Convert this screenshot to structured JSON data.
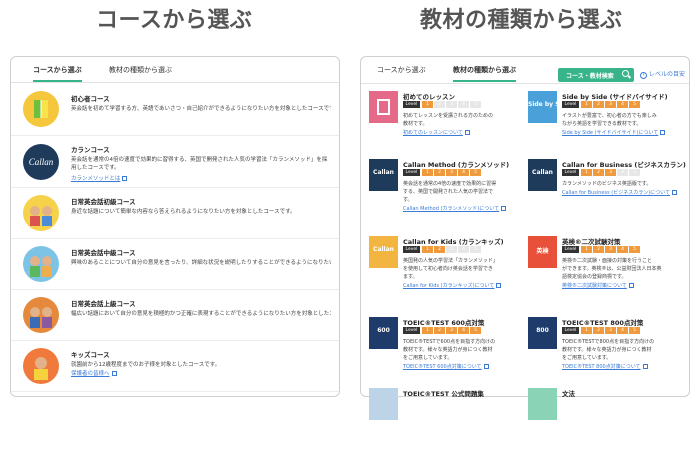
{
  "headings": {
    "left": "コースから選ぶ",
    "right": "教材の種類から選ぶ"
  },
  "left_panel": {
    "tabs": [
      {
        "label": "コースから選ぶ"
      },
      {
        "label": "教材の種類から選ぶ"
      }
    ],
    "courses": [
      {
        "title": "初心者コース",
        "desc": "英会話を初めて学習する方、英語であいさつ・自己紹介ができるようになりたい方を対象としたコースです。",
        "link": ""
      },
      {
        "title": "カランコース",
        "desc": "英会話を通常の4倍の速度で効果的に習得する、英国で開発された人気の学習法「カランメソッド」を採用したコースです。",
        "link": "カランメソッドとは"
      },
      {
        "title": "日常英会話初級コース",
        "desc": "身近な話題について簡単な内容なら答えられるようになりたい方を対象としたコースです。",
        "link": ""
      },
      {
        "title": "日常英会話中級コース",
        "desc": "興味のあることについて自分の意見を言ったり、詳細な状況を説明したりすることができるようになりたい方を対象としたコースです。",
        "link": ""
      },
      {
        "title": "日常英会話上級コース",
        "desc": "幅広い話題において自分の意見を積極的かつ正確に表現することができるようになりたい方を対象としたコースです。",
        "link": ""
      },
      {
        "title": "キッズコース",
        "desc": "就園前から12歳程度までのお子様を対象としたコースです。",
        "link": "保護者の皆様へ"
      }
    ]
  },
  "right_panel": {
    "tabs": [
      {
        "label": "コースから選ぶ"
      },
      {
        "label": "教材の種類から選ぶ"
      }
    ],
    "search_button": "コース・教材検索",
    "level_help": "レベルの目安",
    "level_label": "Level",
    "cards": [
      {
        "title": "初めてのレッスン",
        "level_on": 1,
        "desc": [
          "初めてレッスンを受講される方のための",
          "教材です。"
        ],
        "link": "初めてのレッスンについて",
        "thumb_color": "#e56a8a",
        "thumb_text": ""
      },
      {
        "title": "Side by Side (サイドバイサイド)",
        "level_on": 5,
        "desc": [
          "イラストが豊富で、初心者の方でも楽しみ",
          "ながら英語を学習できる教材です。"
        ],
        "link": "Side by Side (サイドバイサイド)について",
        "thumb_color": "#4aa0d8",
        "thumb_text": "Side by Side"
      },
      {
        "title": "Callan Method (カランメソッド)",
        "level_on": 5,
        "desc": [
          "英会話を通常の4倍の速度で効果的に習得",
          "する、英国で開発された人気の学習法で",
          "す。"
        ],
        "link": "Callan Method (カランメソッド)について",
        "thumb_color": "#1f3b5c",
        "thumb_text": "Callan"
      },
      {
        "title": "Callan for Business (ビジネスカラン)",
        "level_on": 3,
        "desc": [
          "カランメソッドのビジネス英語版です。"
        ],
        "link": "Callan for Business (ビジネスカラン)について",
        "thumb_color": "#1f3b5c",
        "thumb_text": "Callan"
      },
      {
        "title": "Callan for Kids (カランキッズ)",
        "level_on": 2,
        "desc": [
          "英国発の人気の学習法「カランメソッド」",
          "を使用して初心者向け英会話を学習でき",
          "ます。"
        ],
        "link": "Callan for Kids (カランキッズ)について",
        "thumb_color": "#f2b640",
        "thumb_text": "Callan"
      },
      {
        "title": "英検®二次試験対策",
        "level_on": 5,
        "desc": [
          "英検®二次試験・面接の対策を行うこと",
          "ができます。英検®は、公益財団法人日本英",
          "語検定協会の登録商標です。"
        ],
        "link": "英検®二次試験対策について",
        "thumb_color": "#e8503a",
        "thumb_text": "英検"
      },
      {
        "title": "TOEIC®TEST 600点対策",
        "level_on": 5,
        "desc": [
          "TOEIC®TESTで600点を目指す方向けの",
          "教材です。様々な英語力が身につく教材",
          "をご用意しています。"
        ],
        "link": "TOEIC®TEST 600点対策について",
        "thumb_color": "#1f3b6c",
        "thumb_text": "600"
      },
      {
        "title": "TOEIC®TEST 800点対策",
        "level_on": 5,
        "desc": [
          "TOEIC®TESTで800点を目指す方向けの",
          "教材です。様々な英語力が身につく教材",
          "をご用意しています。"
        ],
        "link": "TOEIC®TEST 800点対策について",
        "thumb_color": "#1f3b6c",
        "thumb_text": "800"
      },
      {
        "title": "TOEIC®TEST 公式問題集",
        "level_on": 0,
        "desc": [],
        "link": "",
        "thumb_color": "#bcd3e8",
        "thumb_text": ""
      },
      {
        "title": "文法",
        "level_on": 0,
        "desc": [],
        "link": "",
        "thumb_color": "#8bd3b6",
        "thumb_text": ""
      }
    ]
  }
}
